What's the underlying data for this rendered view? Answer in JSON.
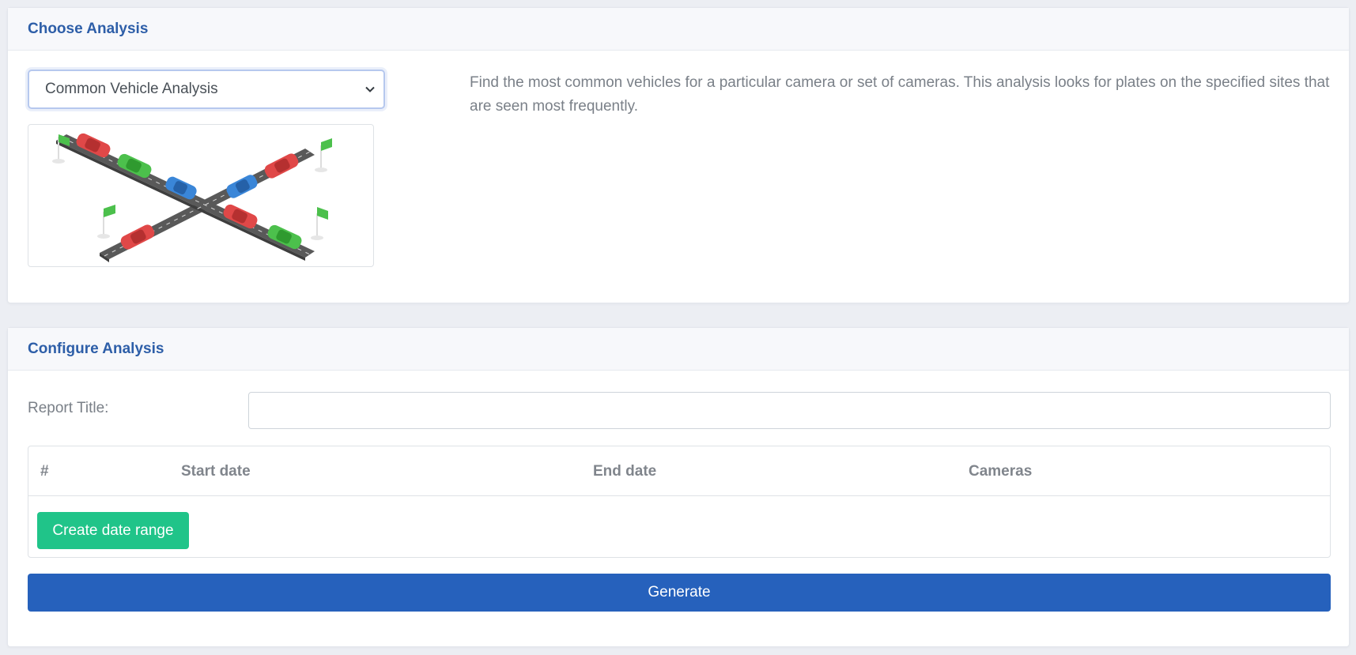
{
  "choose_section": {
    "title": "Choose Analysis",
    "selected_analysis": "Common Vehicle Analysis",
    "description": "Find the most common vehicles for a particular camera or set of cameras. This analysis looks for plates on the specified sites that are seen most frequently.",
    "illustration_icon": "intersection-cars-illustration"
  },
  "configure_section": {
    "title": "Configure Analysis",
    "report_title_label": "Report Title:",
    "report_title_value": "",
    "table": {
      "columns": [
        "#",
        "Start date",
        "End date",
        "Cameras"
      ],
      "rows": []
    },
    "create_button_label": "Create date range",
    "generate_button_label": "Generate"
  },
  "colors": {
    "header_text": "#2d5ea8",
    "create_button": "#20c489",
    "generate_button": "#2661bc",
    "car_red": "#e04848",
    "car_green": "#4cc04c",
    "car_blue": "#3a86d8",
    "road": "#595959"
  }
}
